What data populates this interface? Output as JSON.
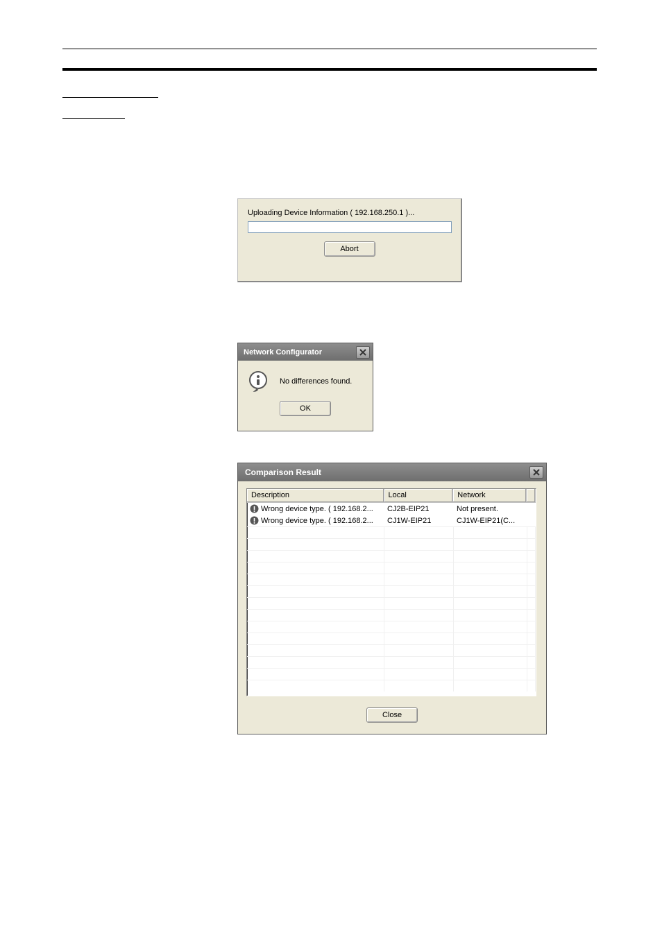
{
  "dlg1": {
    "message": "Uploading Device Information ( 192.168.250.1 )...",
    "abort_label": "Abort"
  },
  "dlg2": {
    "title": "Network Configurator",
    "message": "No differences found.",
    "ok_label": "OK"
  },
  "dlg3": {
    "title": "Comparison Result",
    "columns": {
      "description": "Description",
      "local": "Local",
      "network": "Network"
    },
    "rows": [
      {
        "description": "Wrong device type. ( 192.168.2...",
        "local": "CJ2B-EIP21",
        "network": "Not present."
      },
      {
        "description": "Wrong device type. ( 192.168.2...",
        "local": "CJ1W-EIP21",
        "network": "CJ1W-EIP21(C..."
      }
    ],
    "close_label": "Close"
  }
}
